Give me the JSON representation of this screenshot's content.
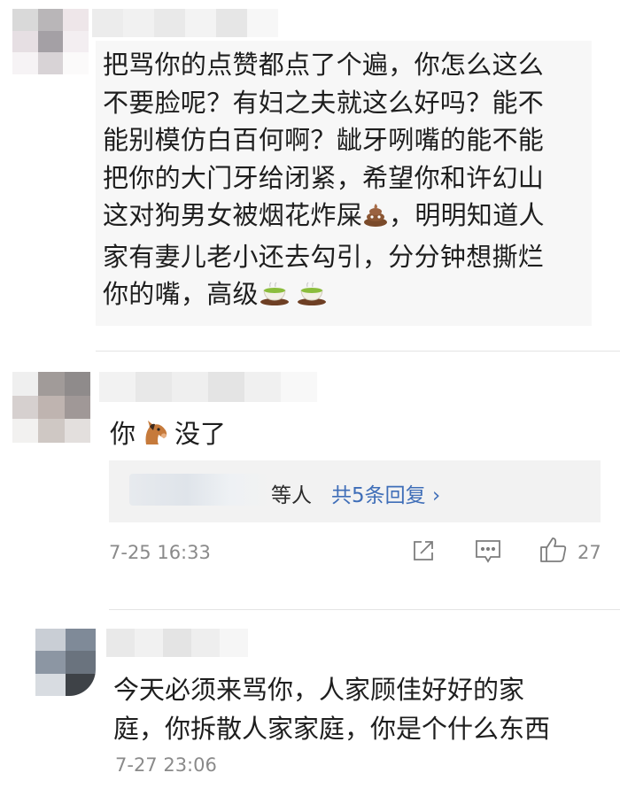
{
  "comments": [
    {
      "text_line1": "把骂你的点赞都点了个遍，你怎么这么",
      "text_line2": "不要脸呢？有妇之夫就这么好吗？能不",
      "text_line3": "能别模仿白百何啊？龇牙咧嘴的能不能",
      "text_line4": "把你的大门牙给闭紧，希望你和许幻山",
      "text_line5a": "这对狗男女被烟花炸屎",
      "text_line5b": "，明明知道人",
      "text_line6": "家有妻儿老小还去勾引，分分钟想撕烂",
      "text_line7": "你的嘴，高级",
      "emoji_poop": "poop-emoji",
      "emoji_tea": "green-tea-emoji"
    },
    {
      "text_before": "你",
      "text_after": "没了",
      "emoji_horse": "horse-face-emoji",
      "replies_suffix": "等人",
      "replies_link": "共5条回复 ›",
      "timestamp": "7-25 16:33",
      "like_count": "27",
      "icons": [
        "share-icon",
        "comment-icon",
        "thumbs-up-icon"
      ]
    },
    {
      "text_line1": "今天必须来骂你，人家顾佳好好的家",
      "text_line2": "庭，你拆散人家家庭，你是个什么东西",
      "timestamp": "7-27 23:06"
    }
  ],
  "colors": {
    "text": "#1e1e1e",
    "meta": "#8a8a8a",
    "link": "#3f6eb8",
    "quote_bg": "#f7f7f7",
    "reply_bg": "#f2f2f2"
  }
}
